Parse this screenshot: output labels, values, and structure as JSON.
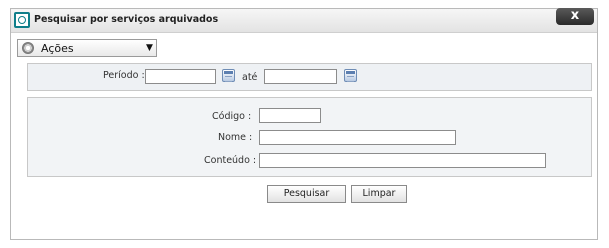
{
  "dialog": {
    "title": "Pesquisar por serviços arquivados",
    "close_label": "x",
    "app_icon": "app-logo-icon"
  },
  "actions": {
    "label": "Ações",
    "icon": "gear-icon",
    "arrow": "▼"
  },
  "period": {
    "label": "Período :",
    "from_value": "",
    "until_label": "até",
    "to_value": ""
  },
  "search": {
    "code_label": "Código :",
    "code_value": "",
    "name_label": "Nome :",
    "name_value": "",
    "content_label": "Conteúdo :",
    "content_value": ""
  },
  "buttons": {
    "search_label": "Pesquisar",
    "clear_label": "Limpar"
  }
}
